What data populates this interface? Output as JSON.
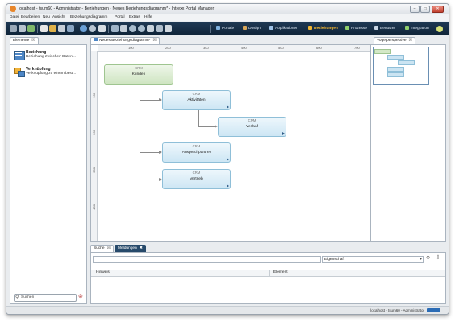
{
  "window": {
    "title": "localhost - tsum60 - Administrator - Beziehungen - Neues Beziehungsdiagramm* - Intrexx Portal Manager",
    "controls": {
      "minimize": "–",
      "maximize": "□",
      "close": "✕"
    }
  },
  "menu": [
    "Datei",
    "Bearbeiten",
    "Neu",
    "Ansicht",
    "Beziehungsdiagramm",
    "Portal",
    "Extras",
    "Hilfe"
  ],
  "perspectives": [
    {
      "label": "Portale",
      "icon": "portal-icon",
      "color": "#7fb2e0"
    },
    {
      "label": "Design",
      "icon": "design-icon",
      "color": "#d8a75a"
    },
    {
      "label": "Applikationen",
      "icon": "applications-icon",
      "color": "#9fc2e6"
    },
    {
      "label": "Beziehungen",
      "icon": "relations-icon",
      "color": "#f2b632",
      "active": true
    },
    {
      "label": "Prozesse",
      "icon": "processes-icon",
      "color": "#8fcf6a"
    },
    {
      "label": "Benutzer",
      "icon": "users-icon",
      "color": "#c9d6e4"
    },
    {
      "label": "Integration",
      "icon": "integration-icon",
      "color": "#8fd06c"
    }
  ],
  "palette": {
    "tab": "Elemente",
    "items": [
      {
        "title": "Beziehung",
        "desc": "Beziehung zwischen Daten...",
        "icon": "relation-icon"
      },
      {
        "title": "Verknüpfung",
        "desc": "Verknüpfung zu einem best...",
        "icon": "link-icon"
      }
    ],
    "search_label": "Suchen"
  },
  "editor": {
    "tab": "Neues Beziehungsdiagramm*",
    "ruler_h": [
      "100",
      "200",
      "300",
      "400",
      "500",
      "600",
      "700"
    ],
    "ruler_v": [
      "100",
      "200",
      "300",
      "400",
      "500"
    ],
    "nodes": [
      {
        "stereotype": "CRM",
        "name": "Kunden"
      },
      {
        "stereotype": "CRM",
        "name": "Aktivitäten"
      },
      {
        "stereotype": "CRM",
        "name": "Verlauf"
      },
      {
        "stereotype": "CRM",
        "name": "Ansprechpartner"
      },
      {
        "stereotype": "CRM",
        "name": "Vertrieb"
      }
    ]
  },
  "overview": {
    "tab": "Vogelperspektive"
  },
  "bottom": {
    "tabs": [
      "Suche",
      "Meldungen"
    ],
    "property_label": "Eigenschaft",
    "columns": [
      "Hinweis",
      "Element"
    ]
  },
  "status": {
    "text": "localhost - tsum60 - Administrator"
  }
}
